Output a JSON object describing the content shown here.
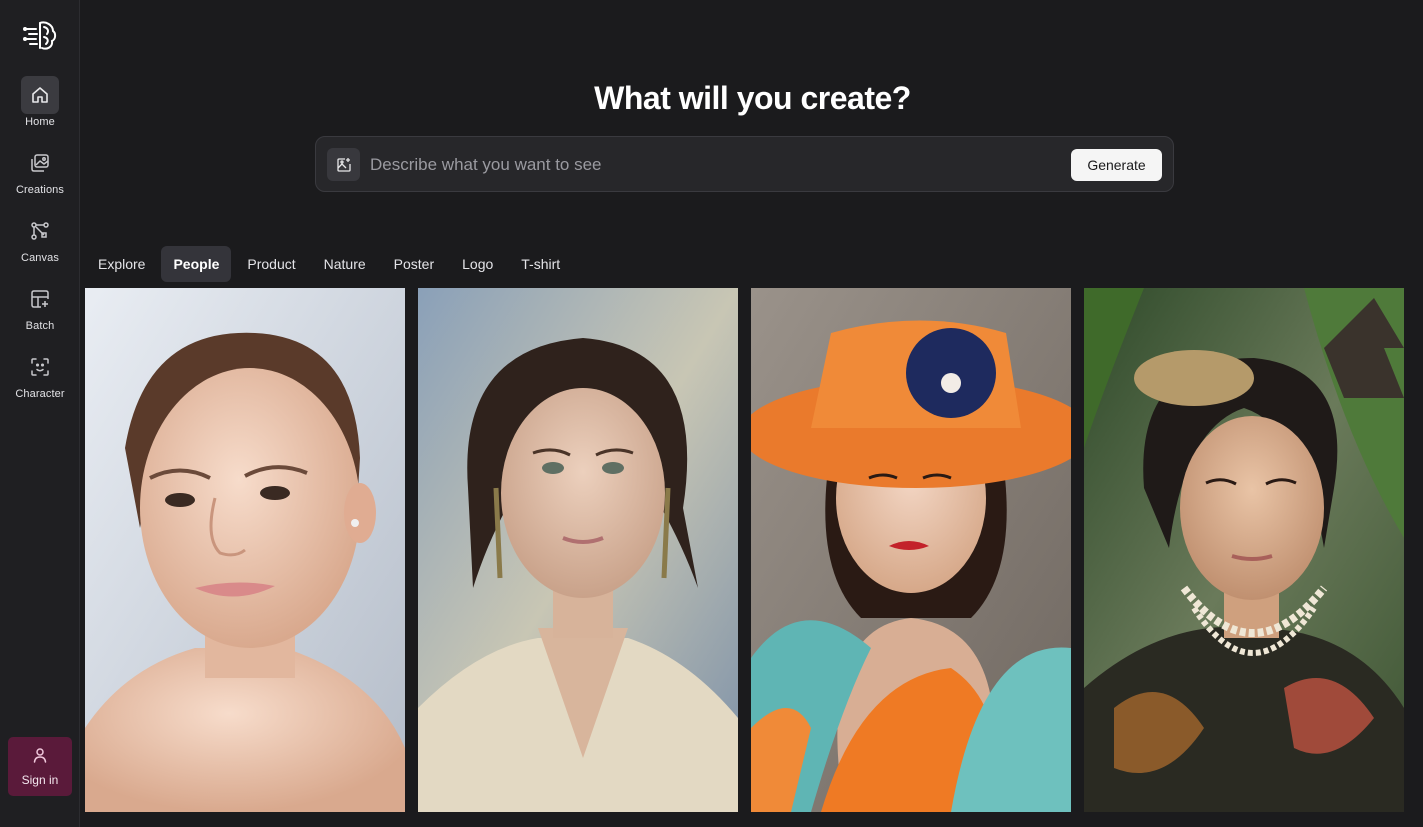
{
  "sidebar": {
    "logo_icon": "brain-circuit-logo",
    "items": [
      {
        "label": "Home",
        "icon": "home-icon",
        "active": true
      },
      {
        "label": "Creations",
        "icon": "images-icon",
        "active": false
      },
      {
        "label": "Canvas",
        "icon": "nodes-icon",
        "active": false
      },
      {
        "label": "Batch",
        "icon": "batch-icon",
        "active": false
      },
      {
        "label": "Character",
        "icon": "face-scan-icon",
        "active": false
      }
    ],
    "signin_label": "Sign in",
    "signin_icon": "user-icon"
  },
  "hero": {
    "title": "What will you create?"
  },
  "prompt": {
    "placeholder": "Describe what you want to see",
    "value": "",
    "image_button_icon": "image-add-icon",
    "generate_label": "Generate"
  },
  "tabs": [
    {
      "label": "Explore",
      "active": false
    },
    {
      "label": "People",
      "active": true
    },
    {
      "label": "Product",
      "active": false
    },
    {
      "label": "Nature",
      "active": false
    },
    {
      "label": "Poster",
      "active": false
    },
    {
      "label": "Logo",
      "active": false
    },
    {
      "label": "T-shirt",
      "active": false
    }
  ],
  "gallery": [
    {
      "subject": "portrait-woman-glowing-skin"
    },
    {
      "subject": "portrait-woman-dark-curly-hair"
    },
    {
      "subject": "portrait-woman-orange-hat"
    },
    {
      "subject": "portrait-woman-traditional-attire"
    }
  ],
  "colors": {
    "background": "#1b1b1d",
    "sidebar": "#1f1f22",
    "signin_bg": "#5a1a3a",
    "accent_white": "#f5f5f5"
  }
}
